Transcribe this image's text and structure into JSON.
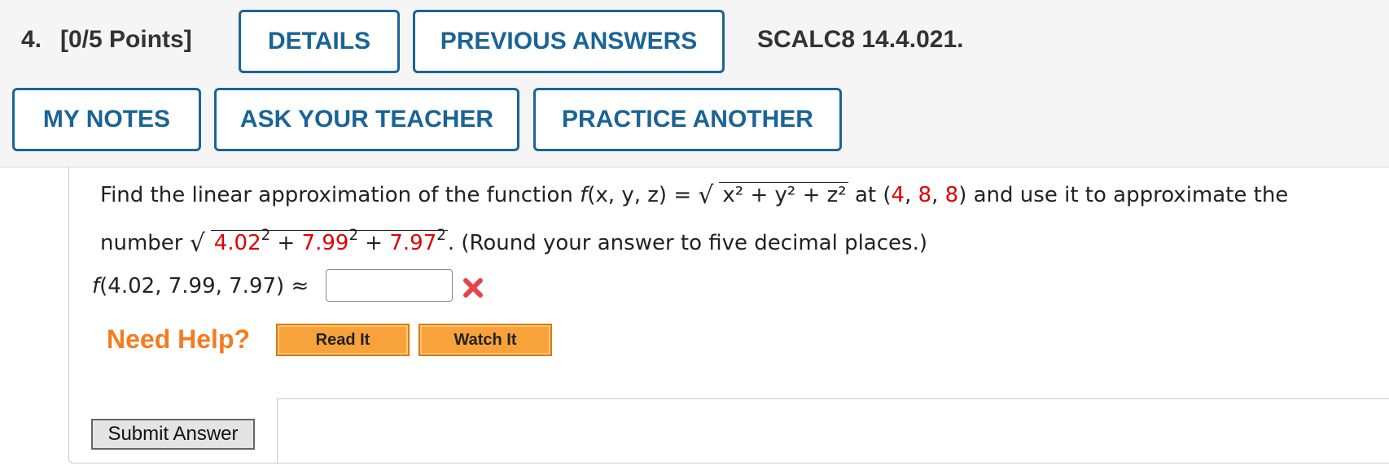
{
  "header": {
    "question_number": "4.",
    "points": "[0/5 Points]",
    "details_label": "DETAILS",
    "previous_answers_label": "PREVIOUS ANSWERS",
    "problem_code": "SCALC8 14.4.021.",
    "my_notes_label": "MY NOTES",
    "ask_teacher_label": "ASK YOUR TEACHER",
    "practice_another_label": "PRACTICE ANOTHER"
  },
  "question": {
    "intro": "Find the linear approximation of the function ",
    "func_f": "f",
    "func_args": "(x, y, z) = ",
    "radicand_fn": "x² + y² + z²",
    "at_text": " at (",
    "point_x": "4",
    "comma1": ", ",
    "point_y": "8",
    "comma2": ", ",
    "point_z": "8",
    "after_point": ") and use it to approximate the",
    "line2_start": "number ",
    "num_a": "4.02",
    "num_b": "7.99",
    "num_c": "7.97",
    "plus": " + ",
    "exp": "2",
    "line2_end": ". (Round your answer to five decimal places.)",
    "answer_label_f": "f",
    "answer_label_rest": "(4.02, 7.99, 7.97) ≈",
    "answer_value": "",
    "answer_status": "incorrect"
  },
  "help": {
    "need_help": "Need Help?",
    "read_it": "Read It",
    "watch_it": "Watch It"
  },
  "submit_label": "Submit Answer",
  "colors": {
    "button_border": "#1a6496",
    "highlight_red": "#e00000",
    "need_help_orange": "#f47b20",
    "help_button": "#f7a23a"
  },
  "icons": {
    "wrong": "red-x-icon"
  }
}
